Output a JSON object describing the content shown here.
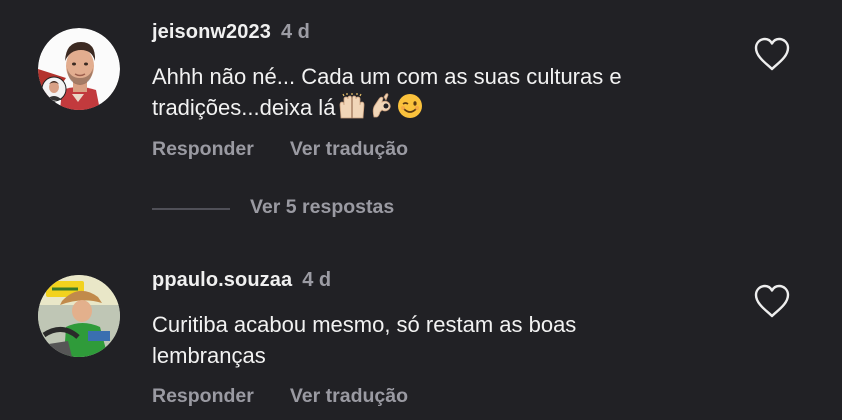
{
  "comments": [
    {
      "username": "jeisonw2023",
      "age": "4 d",
      "text_lines": [
        "Ahhh não né... Cada um com as suas culturas e",
        "tradições...deixa lá"
      ],
      "emojis": [
        "raising-hands",
        "ok-hand",
        "winking-face"
      ],
      "reply_label": "Responder",
      "translate_label": "Ver tradução",
      "view_replies_label": "Ver 5 respostas"
    },
    {
      "username": "ppaulo.souzaa",
      "age": "4 d",
      "text_lines": [
        "Curitiba acabou mesmo, só restam as boas",
        "lembranças"
      ],
      "reply_label": "Responder",
      "translate_label": "Ver tradução"
    }
  ],
  "icons": {
    "like": "heart-outline-icon"
  },
  "colors": {
    "background": "#212125",
    "primary_text": "#f2f2f2",
    "secondary_text": "#9a9aa2"
  }
}
